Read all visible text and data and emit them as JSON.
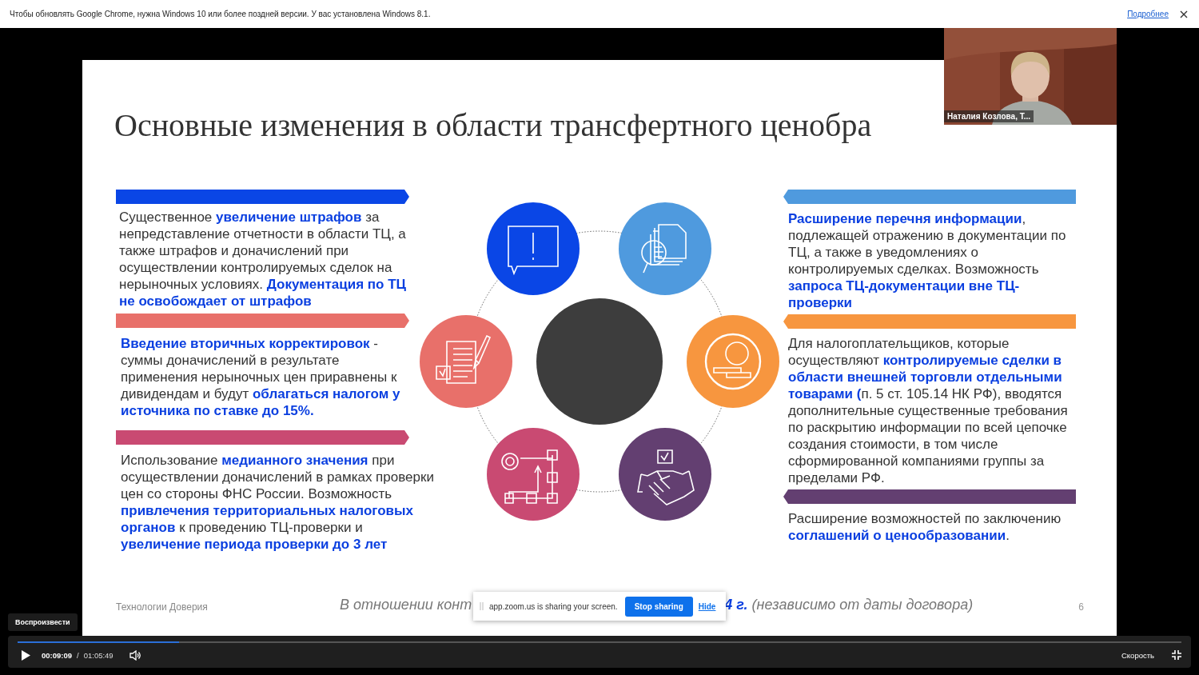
{
  "update_banner": {
    "message": "Чтобы обновлять Google Chrome, нужна Windows 10 или более поздней версии. У вас установлена Windows 8.1.",
    "link": "Подробнее"
  },
  "slide": {
    "title": "Основные изменения в области трансфертного ценобра",
    "left_blocks": [
      {
        "color": "#0a46e6",
        "text": "Существенное **увеличение штрафов** за непредставление отчетности в области ТЦ, а также штрафов и доначислений при осуществлении контролируемых сделок на нерыночных условиях. **Документация по ТЦ не освобождает от штрафов**"
      },
      {
        "color": "#e8706a",
        "text": "**Введение вторичных корректировок** - суммы доначислений в результате применения нерыночных цен приравнены к дивидендам и будут **облагаться налогом у источника по ставке до 15%.**"
      },
      {
        "color": "#c94a72",
        "text": "Использование **медианного значения** при осуществлении доначислений в рамках проверки цен со стороны ФНС России. Возможность **привлечения территориальных налоговых органов** к проведению ТЦ-проверки и **увеличение периода проверки до 3 лет**"
      }
    ],
    "diagram": {
      "nodes": [
        {
          "kind": "alert",
          "color": "#0a46e6"
        },
        {
          "kind": "documents",
          "color": "#4f9ade"
        },
        {
          "kind": "contract",
          "color": "#e8706a"
        },
        {
          "kind": "coins",
          "color": "#f7963f"
        },
        {
          "kind": "process",
          "color": "#c94a72"
        },
        {
          "kind": "handshake",
          "color": "#633f71"
        }
      ]
    },
    "right_blocks": [
      {
        "color": "#4f9ade",
        "text": "**Расширение перечня информации**, подлежащей отражению в документации по ТЦ, а также в уведомлениях о контролируемых сделках. Возможность **запроса ТЦ-документации вне ТЦ-проверки**"
      },
      {
        "color": "#f7963f",
        "text": "Для налогоплательщиков, которые осуществляют **контролируемые сделки в области внешней торговли отдельными товарами (**п. 5 ст. 105.14 НК РФ), вводятся дополнительные существенные требования по раскрытию информации по всей цепочке создания стоимости, в том числе сформированной компаниями группы за пределами РФ."
      },
      {
        "color": "#633f71",
        "text": "Расширение возможностей по заключению **соглашений о ценообразовании**."
      }
    ],
    "footer": {
      "brand": "Технологии Доверия",
      "note_parts": [
        "В отношении конт",
        "**4 г.** (независимо от даты договора)"
      ],
      "page": "6"
    }
  },
  "webcam": {
    "name": "Наталия Козлова, Т..."
  },
  "share_notice": {
    "message": "app.zoom.us is sharing your screen.",
    "stop_button": "Stop sharing",
    "hide_link": "Hide"
  },
  "tooltip": "Воспроизвести",
  "player": {
    "level": 0.139,
    "current_time": "00:09:09",
    "separator": "/",
    "duration": "01:05:49",
    "speed": "Скорость"
  }
}
